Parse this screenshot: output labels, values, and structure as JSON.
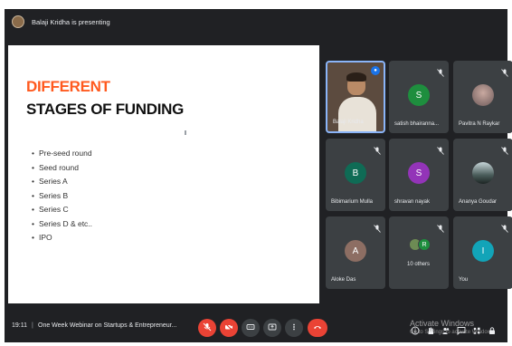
{
  "presenter_bar": {
    "text": "Balaji Kridha is presenting"
  },
  "slide": {
    "title_line1": "DIFFERENT",
    "title_line2": "STAGES OF FUNDING",
    "bullets": [
      "Pre-seed round",
      "Seed round",
      "Series A",
      "Series B",
      "Series C",
      "Series D & etc..",
      "IPO"
    ]
  },
  "participants": [
    {
      "name": "Balaji Kridha",
      "initial": "",
      "color": "#5c4b3f",
      "muted": false,
      "speaking": true
    },
    {
      "name": "satish bhairanna...",
      "initial": "S",
      "color": "#1e8e3e",
      "muted": true
    },
    {
      "name": "Pavitra N Raykar",
      "initial": "",
      "color": "#8a7a7a",
      "muted": true
    },
    {
      "name": "Bibimarium Mulla",
      "initial": "B",
      "color": "#0f6b55",
      "muted": true
    },
    {
      "name": "shravan nayak",
      "initial": "S",
      "color": "#9334b8",
      "muted": true
    },
    {
      "name": "Ananya Goudar",
      "initial": "",
      "color": "#2f3b3a",
      "muted": true
    },
    {
      "name": "Aloke Das",
      "initial": "A",
      "color": "#8d6e63",
      "muted": true
    },
    {
      "name": "10 others",
      "initial": "R",
      "color": "#1e8e3e",
      "muted": true
    },
    {
      "name": "You",
      "initial": "I",
      "color": "#12a4b8",
      "muted": true
    }
  ],
  "bottom_bar": {
    "time": "19:11",
    "separator": "|",
    "meeting_title": "One Week Webinar on Startups & Entrepreneur...",
    "controls": [
      "mic-off",
      "camera-off",
      "captions",
      "present",
      "more",
      "end-call"
    ]
  },
  "watermark": {
    "line1": "Activate Windows",
    "line2": "Go to Settings to activate Windows."
  },
  "colors": {
    "accent_red": "#ea4335",
    "slide_title_accent": "#ff5a1f",
    "background": "#202124",
    "tile": "#3c4043"
  }
}
